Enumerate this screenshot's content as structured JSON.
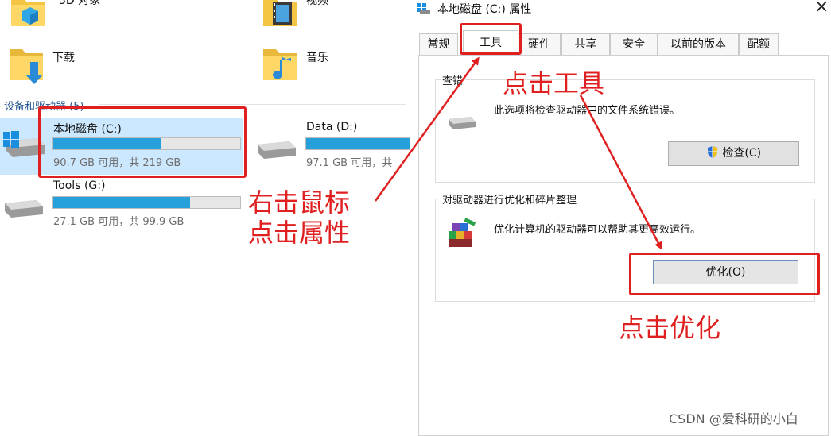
{
  "explorer": {
    "top_items": [
      {
        "label": "3D 对象"
      },
      {
        "label": "视频"
      },
      {
        "label": "下载"
      },
      {
        "label": "音乐"
      }
    ],
    "section_title": "设备和驱动器 (5)",
    "drives": [
      {
        "name": "本地磁盘 (C:)",
        "info": "90.7 GB 可用，共 219 GB",
        "used_fraction": 0.58
      },
      {
        "name": "Data (D:)",
        "info": "97.1 GB 可用，共 ",
        "used_fraction": 0.99
      },
      {
        "name": "Tools (G:)",
        "info": "27.1 GB 可用，共 99.9 GB",
        "used_fraction": 0.73
      }
    ]
  },
  "dialog": {
    "title": "本地磁盘 (C:) 属性",
    "close": "×",
    "tabs": [
      "常规",
      "工具",
      "硬件",
      "共享",
      "安全",
      "以前的版本",
      "配额"
    ],
    "active_tab": "工具",
    "check_group": {
      "title": "查错",
      "description": "此选项将检查驱动器中的文件系统错误。",
      "button": "检查(C)"
    },
    "optimize_group": {
      "title": "对驱动器进行优化和碎片整理",
      "description": "优化计算机的驱动器可以帮助其更高效运行。",
      "button": "优化(O)"
    }
  },
  "annotations": {
    "right_click": [
      "右击鼠标",
      "点击属性"
    ],
    "click_tools": "点击工具",
    "click_optimize": "点击优化",
    "accent": "#e02020"
  },
  "watermark": "CSDN @爱科研的小白"
}
